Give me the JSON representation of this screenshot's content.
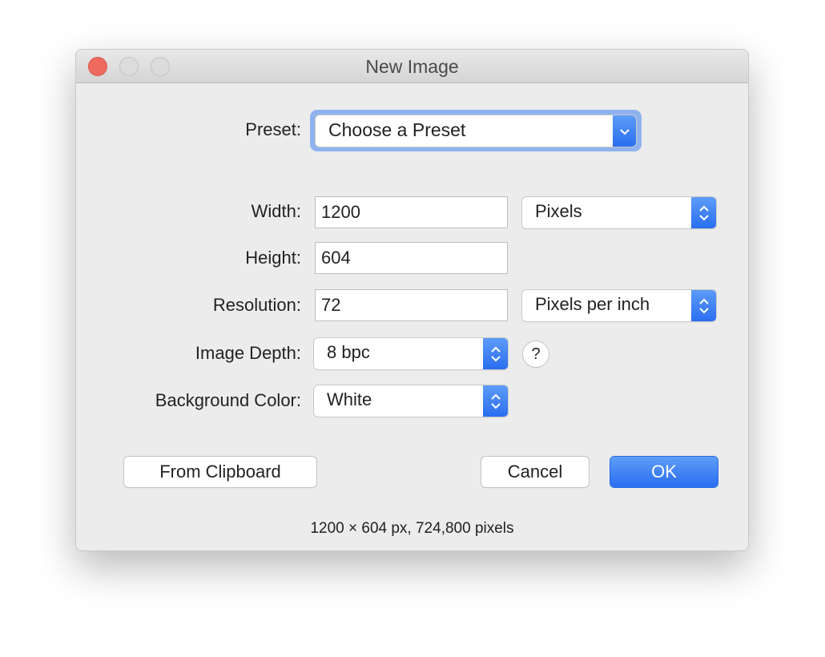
{
  "window": {
    "title": "New Image"
  },
  "preset": {
    "label": "Preset:",
    "value": "Choose a Preset"
  },
  "width": {
    "label": "Width:",
    "value": "1200",
    "unit": "Pixels"
  },
  "height": {
    "label": "Height:",
    "value": "604"
  },
  "resolution": {
    "label": "Resolution:",
    "value": "72",
    "unit": "Pixels per inch"
  },
  "depth": {
    "label": "Image Depth:",
    "value": "8 bpc",
    "help": "?"
  },
  "background": {
    "label": "Background Color:",
    "value": "White"
  },
  "buttons": {
    "clipboard": "From Clipboard",
    "cancel": "Cancel",
    "ok": "OK"
  },
  "footer": "1200 × 604 px, 724,800 pixels",
  "colors": {
    "accent": "#2f74f1",
    "close": "#ee6a5f"
  }
}
